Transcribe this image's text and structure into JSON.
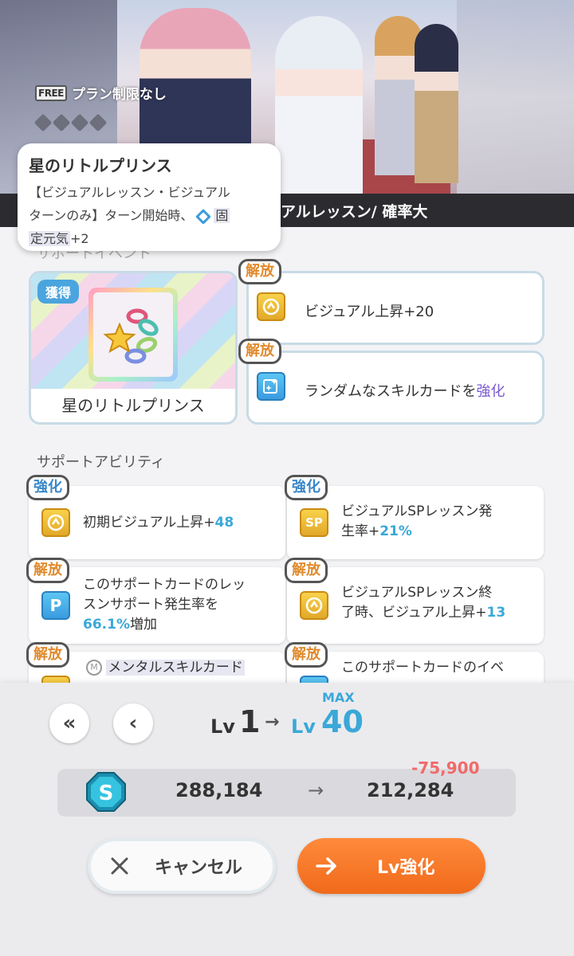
{
  "hero": {
    "free_badge": "FREE",
    "free_text": "プラン制限なし"
  },
  "banner": {
    "text": "アルレッスン/ 確率大"
  },
  "tooltip": {
    "title": "星のリトルプリンス",
    "line1": "【ビジュアルレッスン・ビジュアル",
    "line2a": "ターンのみ】ターン開始時、",
    "line2b": "固",
    "line3a": "定元気",
    "line3b": "+2"
  },
  "support_event": {
    "section_label": "サポートイベント",
    "get_badge": "獲得",
    "card_name": "星のリトルプリンス",
    "unlocks": [
      {
        "tag": "解放",
        "text": "ビジュアル上昇+20",
        "icon": "visual-up-icon"
      },
      {
        "tag": "解放",
        "text_a": "ランダムなスキルカードを",
        "text_b": "強化",
        "icon": "skill-card-enhance-icon"
      }
    ]
  },
  "abilities": {
    "section_label": "サポートアビリティ",
    "items": [
      {
        "tag": "強化",
        "line1a": "初期ビジュアル上昇+",
        "line1b": "48",
        "icon": "visual-up-icon"
      },
      {
        "tag": "強化",
        "line1": "ビジュアルSPレッスン発",
        "line2a": "生率+",
        "line2b": "21%",
        "icon": "sp-icon"
      },
      {
        "tag": "解放",
        "line1": "このサポートカードのレッ",
        "line2": "スンサポート発生率を",
        "line3a": "66.1%",
        "line3b": "増加",
        "icon": "p-icon"
      },
      {
        "tag": "解放",
        "line1": "ビジュアルSPレッスン終",
        "line2a": "了時、ビジュアル上昇+",
        "line2b": "13",
        "icon": "visual-up-icon"
      },
      {
        "tag": "解放",
        "line1": "メンタルスキルカード",
        "icon": "visual-up-icon"
      },
      {
        "tag": "解放",
        "line1": "このサポートカードのイベ",
        "icon": "p-icon"
      }
    ]
  },
  "level": {
    "double_back": "«",
    "back": "‹",
    "lv_label": "Lv",
    "from": "1",
    "arrow": "→",
    "to": "40",
    "max_label": "MAX"
  },
  "cost": {
    "coin_letter": "S",
    "current": "288,184",
    "arrow": "→",
    "after": "212,284",
    "diff": "-75,900"
  },
  "buttons": {
    "cancel": "キャンセル",
    "lv_up": "Lv強化"
  },
  "colors": {
    "accent_blue": "#3aa8d8",
    "orange": "#f06a1a",
    "tag_orange": "#e08a2c",
    "negative": "#f06a6a"
  }
}
